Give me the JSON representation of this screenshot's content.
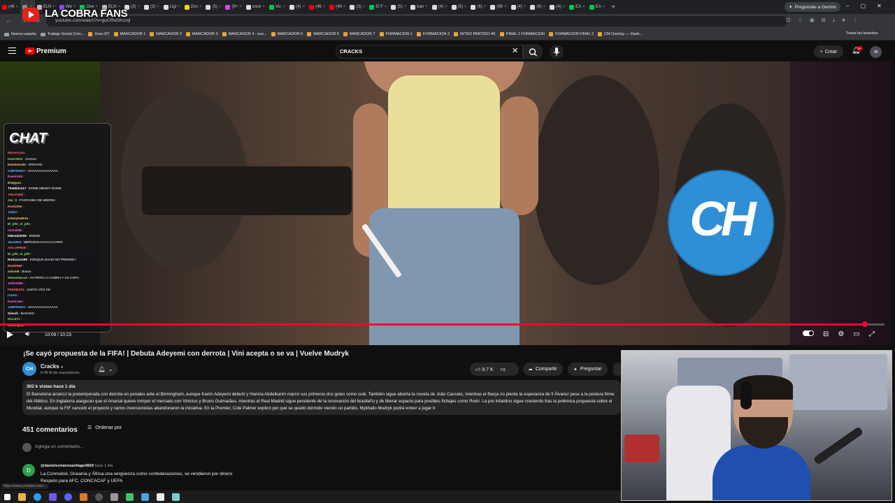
{
  "stream": {
    "title": "LA COBRA FANS"
  },
  "browser": {
    "tabs": [
      {
        "label": "(46",
        "color": "#ff0000"
      },
      {
        "label": "",
        "color": "#888888",
        "active": true
      },
      {
        "label": "ELN",
        "color": "#bbbbbb"
      },
      {
        "label": "We",
        "color": "#9146ff"
      },
      {
        "label": "Ove",
        "color": "#00c853"
      },
      {
        "label": "ELN",
        "color": "#bbbbbb"
      },
      {
        "label": "(3)",
        "color": "#dddddd"
      },
      {
        "label": "(3)",
        "color": "#dddddd"
      },
      {
        "label": "Ligi",
        "color": "#dddddd"
      },
      {
        "label": "Zon",
        "color": "#ffd600"
      },
      {
        "label": "(5)",
        "color": "#dddddd"
      },
      {
        "label": "(9+",
        "color": "#e040fb"
      },
      {
        "label": "vocé",
        "color": "#dddddd"
      },
      {
        "label": "Vo:",
        "color": "#00c853"
      },
      {
        "label": "(4)",
        "color": "#dddddd"
      },
      {
        "label": "(46",
        "color": "#ff0000"
      },
      {
        "label": "(46",
        "color": "#ff0000"
      },
      {
        "label": "(3)",
        "color": "#dddddd"
      },
      {
        "label": "El F",
        "color": "#00c853"
      },
      {
        "label": "(5)",
        "color": "#dddddd"
      },
      {
        "label": "ban",
        "color": "#dddddd"
      },
      {
        "label": "(4)",
        "color": "#dddddd"
      },
      {
        "label": "(5)",
        "color": "#dddddd"
      },
      {
        "label": "(6)",
        "color": "#dddddd"
      },
      {
        "label": "(99",
        "color": "#dddddd"
      },
      {
        "label": "(4)",
        "color": "#dddddd"
      },
      {
        "label": "(6)",
        "color": "#dddddd"
      },
      {
        "label": "(4)",
        "color": "#dddddd"
      },
      {
        "label": "EA",
        "color": "#00c853"
      },
      {
        "label": "EA",
        "color": "#00c853"
      }
    ],
    "new_tab": "+",
    "gemini": "Pregúntale a Gemini",
    "url": "youtube.com/watch?v=goCRw5Kxzql",
    "bookmarks": [
      {
        "label": "Nueva carpeta",
        "type": "folder"
      },
      {
        "label": "Trabajo Social Com...",
        "type": "folder"
      },
      {
        "label": "Gran DT",
        "type": "site"
      },
      {
        "label": "MARCADOR 1",
        "type": "site"
      },
      {
        "label": "MARCADOR 2",
        "type": "site"
      },
      {
        "label": "MARCADOR 3",
        "type": "site"
      },
      {
        "label": "MARCADOR 4 - ove...",
        "type": "site"
      },
      {
        "label": "MARCADOR 5",
        "type": "site"
      },
      {
        "label": "MARCADOR 6",
        "type": "site"
      },
      {
        "label": "MARCADOR 7",
        "type": "site"
      },
      {
        "label": "FORMACION 1",
        "type": "site"
      },
      {
        "label": "FORMACION 2",
        "type": "site"
      },
      {
        "label": "INTRO PARTIDO 4K",
        "type": "site"
      },
      {
        "label": "FINAL 1 FORMACION",
        "type": "site"
      },
      {
        "label": "FORMACION FINAL 2",
        "type": "site"
      },
      {
        "label": "CM Overlay — Dash...",
        "type": "site"
      }
    ],
    "all_bookmarks": "Todos los favoritos"
  },
  "youtube": {
    "premium_label": "Premium",
    "search_query": "CRACKS",
    "create_label": "Crear",
    "notif_count": "9+",
    "avatar_text": "JB"
  },
  "chat": {
    "header": "CHAT",
    "messages": [
      {
        "user": "Maracoyaa",
        "text": ":",
        "color": "#ff6b6b"
      },
      {
        "user": "Inner2001",
        "text": ": JAJAJA",
        "color": "#8ee36b"
      },
      {
        "user": "Danienox42",
        "text": ": GRIXXXII",
        "color": "#ffd36b"
      },
      {
        "user": "xxBFR4522",
        "text": ": UAAAAAAAAAAAAA",
        "color": "#6bb6ff"
      },
      {
        "user": "Ramiro94",
        "text": ":",
        "color": "#ff6bd6"
      },
      {
        "user": "Enzgyaa",
        "text": ":",
        "color": "#ffd36b"
      },
      {
        "user": "TheMido117",
        "text": ": DOME MENDY DOME",
        "color": "#ffffff"
      },
      {
        "user": "Alexs1992",
        "text": ":",
        "color": "#ff6b6b"
      },
      {
        "user": "Jav_X",
        "text": ": FANTASMA DE MIERDA",
        "color": "#8ee36b"
      },
      {
        "user": "Reshi096",
        "text": ":",
        "color": "#ff9a6b"
      },
      {
        "user": "Juliyo",
        "text": ":",
        "color": "#6bb6ff"
      },
      {
        "user": "KennyGaRrio",
        "text": ":",
        "color": "#ffd36b"
      },
      {
        "user": "El_jefe_el_jefe",
        "text": ":",
        "color": "#8ee36b"
      },
      {
        "user": "nicosk36",
        "text": ":",
        "color": "#ff6bd6"
      },
      {
        "user": "leBandi2006",
        "text": ": BOEEE",
        "color": "#ffffff"
      },
      {
        "user": "alex2003",
        "text": ": MERCENAAAAAAAAARIO",
        "color": "#6bb6ff"
      },
      {
        "user": "Alex.MPB45",
        "text": ":",
        "color": "#ff6b6b"
      },
      {
        "user": "El_jefe_el_jefe",
        "text": ":",
        "color": "#8ee36b"
      },
      {
        "user": "Rodryzzz499",
        "text": ": PORQUE DAVID NO PRENDE?",
        "color": "#ffffff"
      },
      {
        "user": "Reshi096",
        "text": ":",
        "color": "#ff9a6b"
      },
      {
        "user": "xsiron8",
        "text": ": Boooo",
        "color": "#ffd36b"
      },
      {
        "user": "elementox14",
        "text": ": AH PERO LA COBRA Y SU COPA",
        "color": "#8ee36b"
      },
      {
        "user": "JuliO1985",
        "text": ":",
        "color": "#ff6bd6"
      },
      {
        "user": "FRENEZ23",
        "text": ": JUSTO VOS XD",
        "color": "#ff6b6b"
      },
      {
        "user": "rozetx",
        "text": ":",
        "color": "#6bb6ff"
      },
      {
        "user": "Ramiro94",
        "text": ":",
        "color": "#ff6bd6"
      },
      {
        "user": "xxBFR4522",
        "text": ": UAAAAAAAAAAAAA",
        "color": "#6bb6ff"
      },
      {
        "user": "Sinesh",
        "text": ": BASADO",
        "color": "#ffffff"
      },
      {
        "user": "Nicc671",
        "text": ":",
        "color": "#8ee36b"
      },
      {
        "user": "moosep61",
        "text": ":",
        "color": "#ffd36b"
      }
    ]
  },
  "player": {
    "time": "10:09 / 10:23",
    "progress": 0.978
  },
  "video": {
    "title": "¡Se cayó propuesta de la FIFA! | Debuta Adeyemi con derrota | Vini acepta o se va | Vuelve Mudryk",
    "channel": "Cracks",
    "channel_avatar": "CH",
    "subscribers": "6.06 M de suscriptores",
    "likes": "9.7 K",
    "share": "Compartir",
    "ask": "Preguntar",
    "meta": "302 k vistas  hace 1 día",
    "description": "El Barcelona arrancó la pretemporada con derrota en penales ante el Birmingham, aunque Karim Adeyemi debutó y Hamza Abdelkarim marcó sus primeros dos goles como culé. También sigue abierta la novela de João Cancelo, mientras el Barça no pierde la esperanza de fi Álvarez pese a la postura firme del Atlético. En Inglaterra aseguran que el Arsenal quiere romper el mercado con Vinícius y Bruno Guimarães, mientras el Real Madrid sigue pendiente de la renovación del brasileño y de liberar espacio para posibles fichajes como Rodri. La pre Infantino sigue creciendo tras la polémica propuesta sobre el Mundial, aunque la FIF canceló el proyecto y varios inversionistas abandonaron la iniciativa. En la Premier, Cole Palmer explicó por qué se quedó dormido viendo un partido, Mykhailo Mudryk podrá volver a jugar tr"
  },
  "comments": {
    "count": "451 comentarios",
    "sort": "Ordenar por",
    "add_placeholder": "Agrega un comentario...",
    "items": [
      {
        "avatar": "D",
        "author": "@danielsorianosantiago4924",
        "time": "hace 1 día",
        "line1": "La Conmebol, Oceanía y África una vergüenza como confederaciones, se vendieron por dinero",
        "line2": "Respeto para AFC, CONCACAF y  UEFA"
      }
    ]
  },
  "status_url": "https://www.youtube.com/..."
}
